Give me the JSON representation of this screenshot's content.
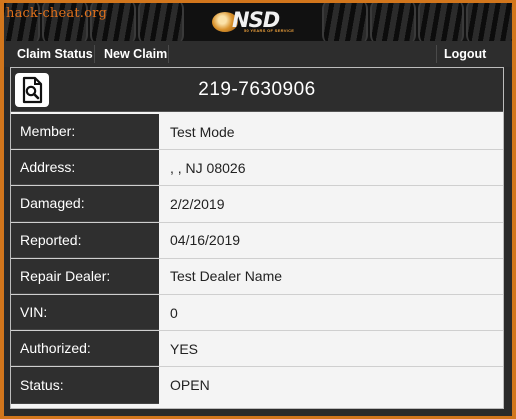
{
  "watermark": "hack-cheat.org",
  "logo": {
    "word": "NSD",
    "tagline": "50 YEARS OF SERVICE"
  },
  "nav": {
    "claim_status": "Claim Status",
    "new_claim": "New Claim",
    "logout": "Logout"
  },
  "claim": {
    "number": "219-7630906",
    "icon": "document-search-icon",
    "fields": [
      {
        "label": "Member:",
        "value": "Test Mode"
      },
      {
        "label": "Address:",
        "value": ", , NJ 08026"
      },
      {
        "label": "Damaged:",
        "value": "2/2/2019"
      },
      {
        "label": "Reported:",
        "value": "04/16/2019"
      },
      {
        "label": "Repair Dealer:",
        "value": "Test Dealer Name"
      },
      {
        "label": "VIN:",
        "value": "0"
      },
      {
        "label": "Authorized:",
        "value": "YES"
      },
      {
        "label": "Status:",
        "value": "OPEN"
      }
    ]
  },
  "colors": {
    "frame_accent": "#d2761c",
    "header_bg": "#2d2d2d",
    "panel_bg": "#f4f4f4"
  }
}
